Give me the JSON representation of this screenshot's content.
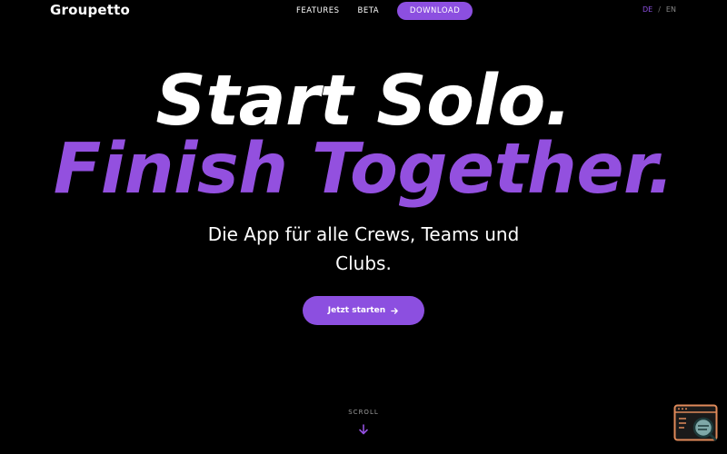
{
  "header": {
    "logo": "Groupetto",
    "nav": {
      "features": "FEATURES",
      "beta": "BETA",
      "download": "DOWNLOAD"
    },
    "lang": {
      "de": "DE",
      "separator": "/",
      "en": "EN",
      "active": "DE"
    }
  },
  "hero": {
    "line1": "Start Solo.",
    "line2": "Finish Together.",
    "subtitle": "Die App für alle Crews, Teams und Clubs.",
    "cta_label": "Jetzt starten",
    "cta_icon": "arrow-right-icon"
  },
  "scroll": {
    "label": "SCROLL",
    "icon": "arrow-down-icon"
  },
  "widget": {
    "icon": "browser-search-widget-icon"
  },
  "colors": {
    "background": "#000000",
    "accent": "#8c4fe0",
    "headline_accent": "#9350df",
    "text": "#ffffff",
    "muted": "#9a9a9a"
  }
}
